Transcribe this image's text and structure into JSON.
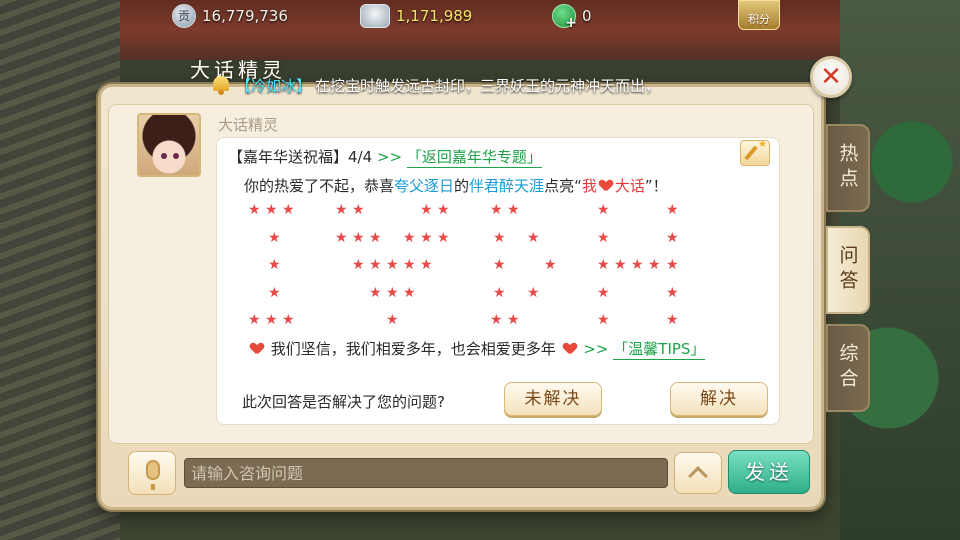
{
  "resources": {
    "contribution": "16,779,736",
    "silver": "1,171,989",
    "jade": "0",
    "score_label": "积分"
  },
  "dialog": {
    "title": "大话精灵",
    "close_label": "✕"
  },
  "announcement": {
    "name": "【冷如冰】",
    "text": "在挖宝时触发远古封印，三界妖王的元神冲天而出，"
  },
  "message": {
    "sender": "大话精灵",
    "header_prefix": "【嘉年华送祝福】4/4",
    "arrow1": ">>",
    "back_link": "「返回嘉年华专题」",
    "line2_a": "你的热爱了不起，恭喜",
    "player1": "夸父逐日",
    "line2_b": "的",
    "player2": "伴君醉天涯",
    "line2_c": "点亮“",
    "line2_d": "我",
    "line2_e": "大话",
    "line2_f": "”！",
    "closing": "我们坚信，我们相爱多年，也会相爱更多年",
    "arrow2": ">>",
    "tips_link": "「温馨TIPS」",
    "question": "此次回答是否解决了您的问题?",
    "unresolved": "未解决",
    "resolved": "解决"
  },
  "side_tabs": {
    "hot": "热点",
    "qa": "问答",
    "all": "综合"
  },
  "input": {
    "placeholder": "请输入咨询问题",
    "send": "发送"
  },
  "colors": {
    "star": "#e84a4a",
    "link_green": "#1fa34a",
    "player_blue": "#1a9ad6",
    "send_green": "#2fae8a"
  }
}
